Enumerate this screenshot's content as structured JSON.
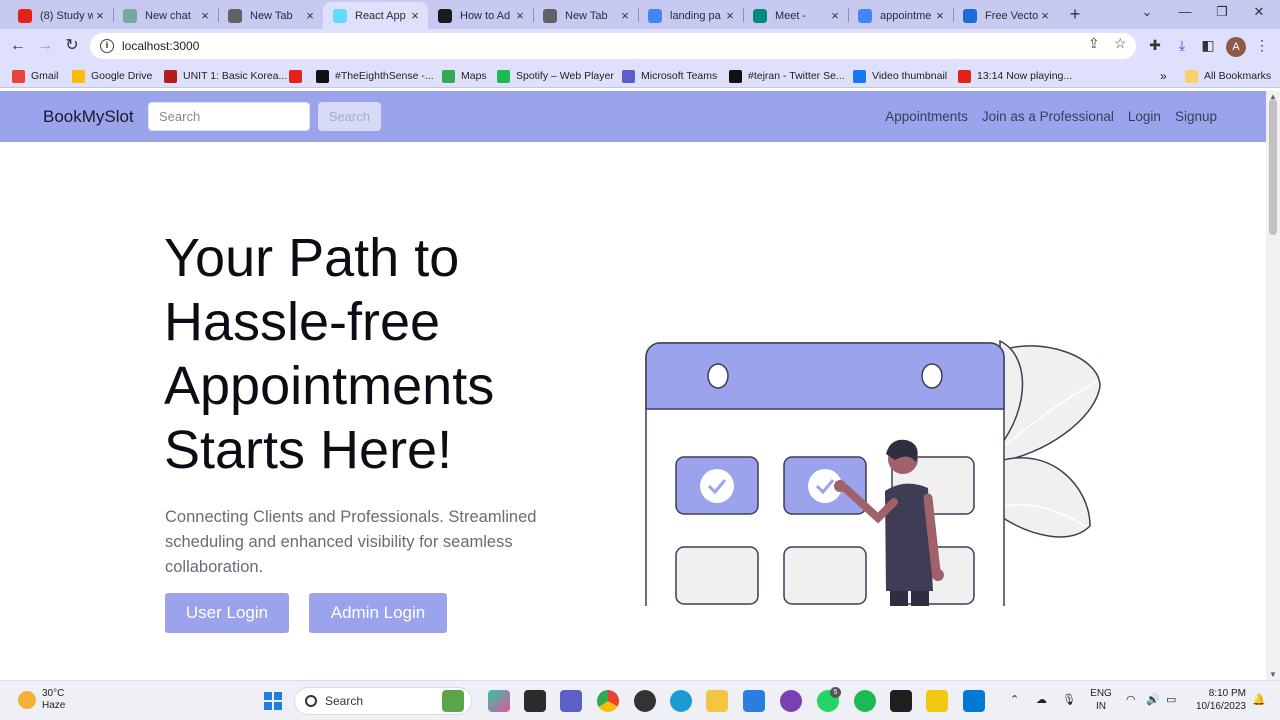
{
  "browser": {
    "tabs": [
      {
        "title": "(8) Study w",
        "icon_color": "#e62117",
        "icon": "youtube-icon"
      },
      {
        "title": "New chat",
        "icon_color": "#74aa9c",
        "icon": "chatgpt-icon"
      },
      {
        "title": "New Tab",
        "icon_color": "#5f6368",
        "icon": "chrome-icon"
      },
      {
        "title": "React App",
        "icon_color": "#61dafb",
        "icon": "react-icon"
      },
      {
        "title": "How to Ad",
        "icon_color": "#1a1a1a",
        "icon": "a-logo-icon"
      },
      {
        "title": "New Tab",
        "icon_color": "#5f6368",
        "icon": "chrome-icon"
      },
      {
        "title": "landing pa",
        "icon_color": "#4285f4",
        "icon": "google-icon"
      },
      {
        "title": "Meet -",
        "icon_color": "#00897b",
        "icon": "meet-icon"
      },
      {
        "title": "appointme",
        "icon_color": "#4285f4",
        "icon": "google-icon"
      },
      {
        "title": "Free Vecto",
        "icon_color": "#1e6ad8",
        "icon": "freepik-icon"
      }
    ],
    "active_tab_index": 3,
    "url": "localhost:3000",
    "profile_initial": "A",
    "bookmarks": [
      {
        "label": "Gmail",
        "color": "#ea4335"
      },
      {
        "label": "Google Drive",
        "color": "#fbbc04"
      },
      {
        "label": "UNIT 1: Basic Korea...",
        "color": "#b71c1c"
      },
      {
        "label": "",
        "color": "#e62117"
      },
      {
        "label": "#TheEighthSense -...",
        "color": "#111111"
      },
      {
        "label": "Maps",
        "color": "#34a853"
      },
      {
        "label": "Spotify – Web Player",
        "color": "#1db954"
      },
      {
        "label": "Microsoft Teams",
        "color": "#5b5fc7"
      },
      {
        "label": "#tejran - Twitter Se...",
        "color": "#111111"
      },
      {
        "label": "Video thumbnail",
        "color": "#1877f2"
      },
      {
        "label": "13:14 Now playing...",
        "color": "#e62117"
      }
    ],
    "bookmarks_overflow": "»",
    "all_bookmarks": "All Bookmarks"
  },
  "app": {
    "brand": "BookMySlot",
    "search_placeholder": "Search",
    "search_button": "Search",
    "nav_links": [
      "Appointments",
      "Join as a Professional",
      "Login",
      "Signup"
    ],
    "hero_title": "Your Path to Hassle-free Appointments Starts Here!",
    "hero_subtitle": "Connecting Clients and Professionals. Streamlined scheduling and enhanced visibility for seamless collaboration.",
    "user_login": "User Login",
    "admin_login": "Admin Login",
    "accent_color": "#9aa3ec"
  },
  "taskbar": {
    "weather_temp": "30°C",
    "weather_desc": "Haze",
    "search_label": "Search",
    "lang_top": "ENG",
    "lang_bottom": "IN",
    "time": "8:10 PM",
    "date": "10/16/2023",
    "whatsapp_badge": "5"
  }
}
